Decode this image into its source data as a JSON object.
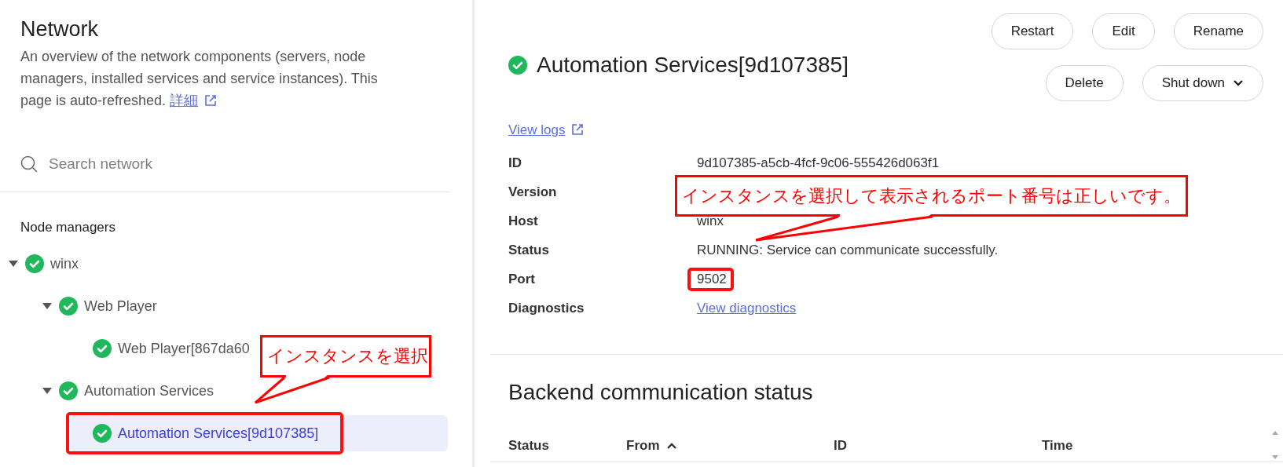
{
  "sidebar": {
    "title": "Network",
    "description": "An overview of the network components (servers, node managers, installed services and service instances). This page is auto-refreshed.",
    "more_link": "詳細",
    "search": {
      "placeholder": "Search network"
    },
    "section_title": "Node managers",
    "tree": [
      {
        "label": "winx",
        "expanded": true,
        "selected": false,
        "children": [
          {
            "label": "Web Player",
            "expanded": true,
            "selected": false,
            "children": [
              {
                "label": "Web Player[867da60",
                "selected": false
              }
            ]
          },
          {
            "label": "Automation Services",
            "expanded": true,
            "selected": false,
            "children": [
              {
                "label": "Automation Services[9d107385]",
                "selected": true,
                "highlighted": true
              }
            ]
          }
        ]
      }
    ]
  },
  "detail": {
    "title": "Automation Services[9d107385]",
    "buttons": [
      {
        "label": "Restart",
        "kind": "plain"
      },
      {
        "label": "Edit",
        "kind": "plain"
      },
      {
        "label": "Rename",
        "kind": "plain"
      },
      {
        "label": "Delete",
        "kind": "plain"
      },
      {
        "label": "Shut down",
        "kind": "menu"
      }
    ],
    "logs_link": "View logs",
    "fields": [
      {
        "label": "ID",
        "kind": "text",
        "value": "9d107385-a5cb-4fcf-9c06-555426d063f1"
      },
      {
        "label": "Version",
        "kind": "hidden"
      },
      {
        "label": "Host",
        "kind": "text",
        "value": "winx"
      },
      {
        "label": "Status",
        "kind": "text",
        "value": "RUNNING: Service can communicate successfully."
      },
      {
        "label": "Port",
        "kind": "text",
        "value": "9502",
        "highlighted": true
      },
      {
        "label": "Diagnostics",
        "kind": "link",
        "value": "View diagnostics"
      }
    ]
  },
  "backend": {
    "title": "Backend communication status",
    "columns": [
      {
        "label": "Status"
      },
      {
        "label": "From",
        "sort_ascending": true
      },
      {
        "label": "ID"
      },
      {
        "label": "Time"
      }
    ]
  },
  "annotations": [
    {
      "kind": "callout",
      "text": "インスタンスを選択"
    },
    {
      "kind": "callout",
      "text": "インスタンスを選択して表示されるポート番号は正しいです。"
    }
  ]
}
